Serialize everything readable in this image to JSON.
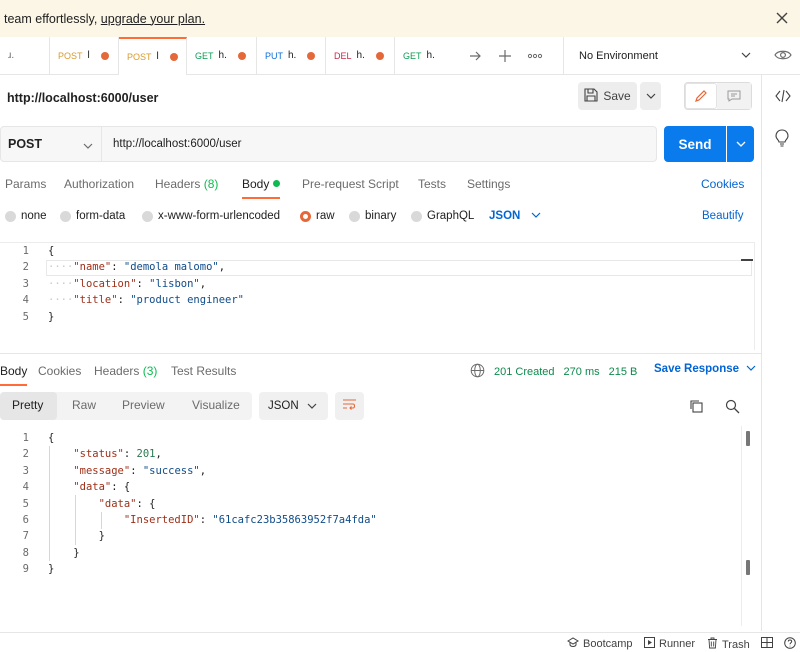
{
  "banner": {
    "text": "team effortlessly, ",
    "link": "upgrade your plan."
  },
  "tabs": [
    {
      "method": "",
      "name": "ɹ.",
      "method_color": "#6b6b6b"
    },
    {
      "method": "POST",
      "name": "l",
      "method_color": "#d99a2c"
    },
    {
      "method": "POST",
      "name": "l",
      "method_color": "#d99a2c"
    },
    {
      "method": "GET",
      "name": "h.",
      "method_color": "#0c9c53"
    },
    {
      "method": "PUT",
      "name": "h.",
      "method_color": "#0b6fd6"
    },
    {
      "method": "DEL",
      "name": "h.",
      "method_color": "#c8284b"
    },
    {
      "method": "GET",
      "name": "h.",
      "method_color": "#0c9c53"
    }
  ],
  "environment": "No Environment",
  "request": {
    "title": "http://localhost:6000/user",
    "save_label": "Save",
    "method": "POST",
    "url": "http://localhost:6000/user",
    "send_label": "Send"
  },
  "request_tabs": {
    "params": "Params",
    "authorization": "Authorization",
    "headers": "Headers",
    "headers_count": "(8)",
    "body": "Body",
    "pre_request": "Pre-request Script",
    "tests": "Tests",
    "settings": "Settings",
    "cookies": "Cookies"
  },
  "body_types": {
    "none": "none",
    "form_data": "form-data",
    "urlencoded": "x-www-form-urlencoded",
    "raw": "raw",
    "binary": "binary",
    "graphql": "GraphQL",
    "format": "JSON",
    "beautify": "Beautify"
  },
  "request_body": {
    "line_numbers": [
      "1",
      "2",
      "3",
      "4",
      "5"
    ],
    "open": "{",
    "fields": [
      {
        "key": "\"name\"",
        "value": "\"demola malomo\"",
        "sep": ","
      },
      {
        "key": "\"location\"",
        "value": "\"lisbon\"",
        "sep": ","
      },
      {
        "key": "\"title\"",
        "value": "\"product engineer\"",
        "sep": ""
      }
    ],
    "close": "}"
  },
  "response_tabs": {
    "body": "Body",
    "cookies": "Cookies",
    "headers": "Headers",
    "headers_count": "(3)",
    "test_results": "Test Results"
  },
  "response_status": {
    "code": "201 Created",
    "time": "270 ms",
    "size": "215 B",
    "save_response": "Save Response"
  },
  "view_modes": {
    "pretty": "Pretty",
    "raw": "Raw",
    "preview": "Preview",
    "visualize": "Visualize",
    "format": "JSON"
  },
  "response_body": {
    "line_numbers": [
      "1",
      "2",
      "3",
      "4",
      "5",
      "6",
      "7",
      "8",
      "9"
    ],
    "l1": "{",
    "status_key": "\"status\"",
    "status_val": "201",
    "message_key": "\"message\"",
    "message_val": "\"success\"",
    "data_key": "\"data\"",
    "inner_key": "\"data\"",
    "id_key": "\"InsertedID\"",
    "id_val": "\"61cafc23b35863952f7a4fda\"",
    "close_inner": "}",
    "close_data": "}",
    "close_root": "}"
  },
  "footer": {
    "bootcamp": "Bootcamp",
    "runner": "Runner",
    "trash": "Trash"
  },
  "colors": {
    "accent": "#ff6c37",
    "primary": "#097bed",
    "link": "#0265d2",
    "success": "#0cbb52"
  }
}
